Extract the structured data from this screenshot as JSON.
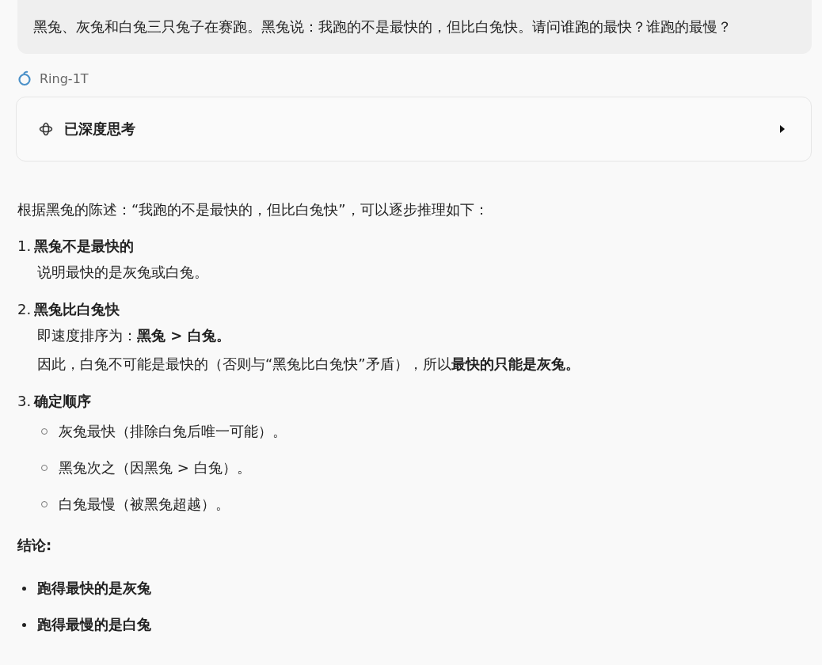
{
  "question": {
    "text": "黑兔、灰兔和白兔三只兔子在赛跑。黑兔说：我跑的不是最快的，但比白兔快。请问谁跑的最快？谁跑的最慢？"
  },
  "model": {
    "name": "Ring-1T"
  },
  "thinking": {
    "label": "已深度思考",
    "expanded": false
  },
  "answer": {
    "intro": "根据黑兔的陈述：“我跑的不是最快的，但比白兔快”，可以逐步推理如下：",
    "steps": [
      {
        "number": "1.",
        "title": "黑兔不是最快的",
        "lines": [
          "说明最快的是灰兔或白兔。"
        ]
      },
      {
        "number": "2.",
        "title": "黑兔比白兔快",
        "lines": [
          "即速度排序为：**黑兔 > 白兔。**",
          "因此，白兔不可能是最快的（否则与“黑兔比白兔快”矛盾），所以**最快的只能是灰兔。**"
        ]
      },
      {
        "number": "3.",
        "title": "确定顺序",
        "bullets": [
          "灰兔最快（排除白兔后唯一可能）。",
          "黑兔次之（因黑兔 > 白兔）。",
          "白兔最慢（被黑兔超越）。"
        ]
      }
    ],
    "conclusion": {
      "heading": "结论:",
      "bullets": [
        "跑得最快的是灰兔",
        "跑得最慢的是白兔"
      ]
    }
  }
}
